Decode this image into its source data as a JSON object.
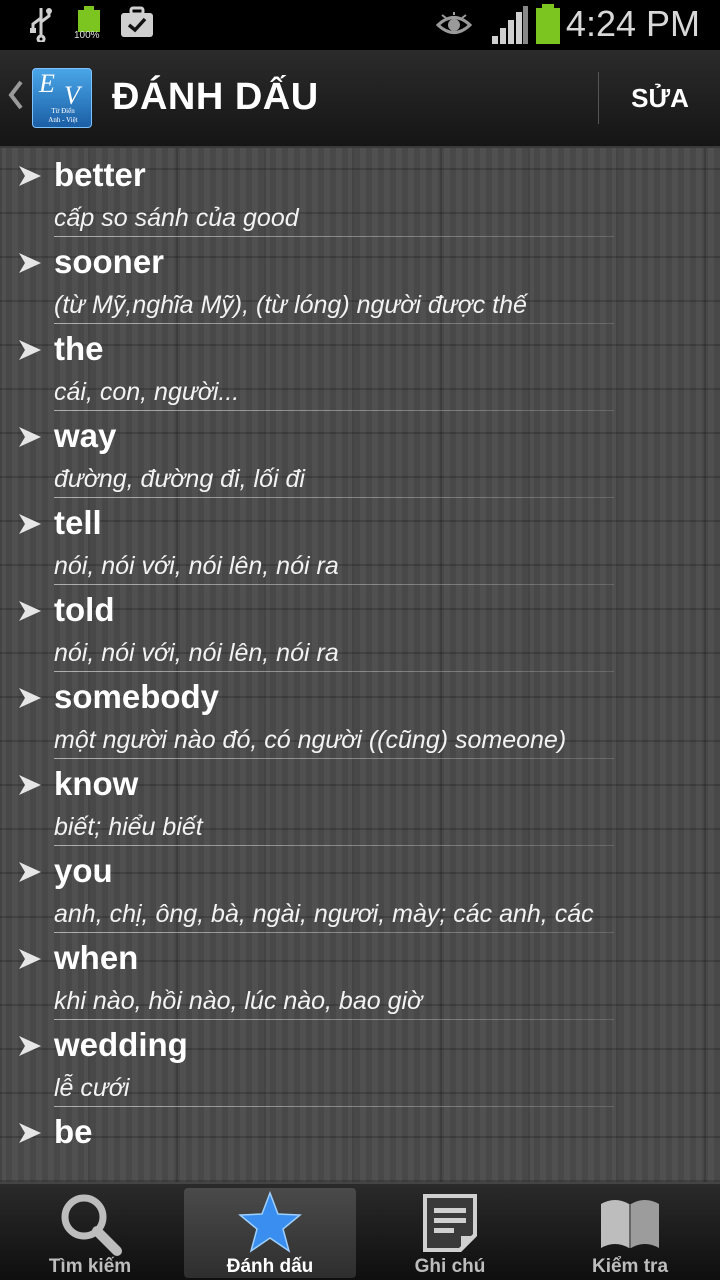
{
  "status_bar": {
    "time": "4:24 PM",
    "battery_label": "100%",
    "icons": [
      "usb-icon",
      "battery-full-icon",
      "briefcase-icon",
      "eye-icon",
      "signal-icon",
      "battery-icon"
    ]
  },
  "header": {
    "back_icon": "chevron-left-icon",
    "logo": {
      "letter_e": "E",
      "letter_v": "V",
      "line1": "Từ Điển",
      "line2": "Anh - Việt"
    },
    "title": "ĐÁNH DẤU",
    "edit_label": "SỬA"
  },
  "bookmarks": [
    {
      "word": "better",
      "meaning": "cấp so sánh của good"
    },
    {
      "word": "sooner",
      "meaning": "(từ Mỹ,nghĩa Mỹ), (từ lóng) người được thế"
    },
    {
      "word": "the",
      "meaning": "cái, con, người..."
    },
    {
      "word": "way",
      "meaning": "đường, đường đi, lối đi"
    },
    {
      "word": "tell",
      "meaning": "nói, nói với, nói lên, nói ra"
    },
    {
      "word": "told",
      "meaning": "nói, nói với, nói lên, nói ra"
    },
    {
      "word": "somebody",
      "meaning": "một người nào đó, có người ((cũng) someone)"
    },
    {
      "word": "know",
      "meaning": "biết; hiểu biết"
    },
    {
      "word": "you",
      "meaning": "anh, chị, ông, bà, ngài, ngươi, mày; các anh, các"
    },
    {
      "word": "when",
      "meaning": "khi nào, hồi nào, lúc nào, bao giờ"
    },
    {
      "word": "wedding",
      "meaning": "lễ cưới"
    },
    {
      "word": "be",
      "meaning": ""
    }
  ],
  "tabs": [
    {
      "label": "Tìm kiếm",
      "icon": "search-icon",
      "selected": false
    },
    {
      "label": "Đánh dấu",
      "icon": "star-icon",
      "selected": true
    },
    {
      "label": "Ghi chú",
      "icon": "note-icon",
      "selected": false
    },
    {
      "label": "Kiểm tra",
      "icon": "book-icon",
      "selected": false
    }
  ],
  "colors": {
    "accent_blue": "#3a8ef0",
    "battery_green": "#7cc520"
  }
}
